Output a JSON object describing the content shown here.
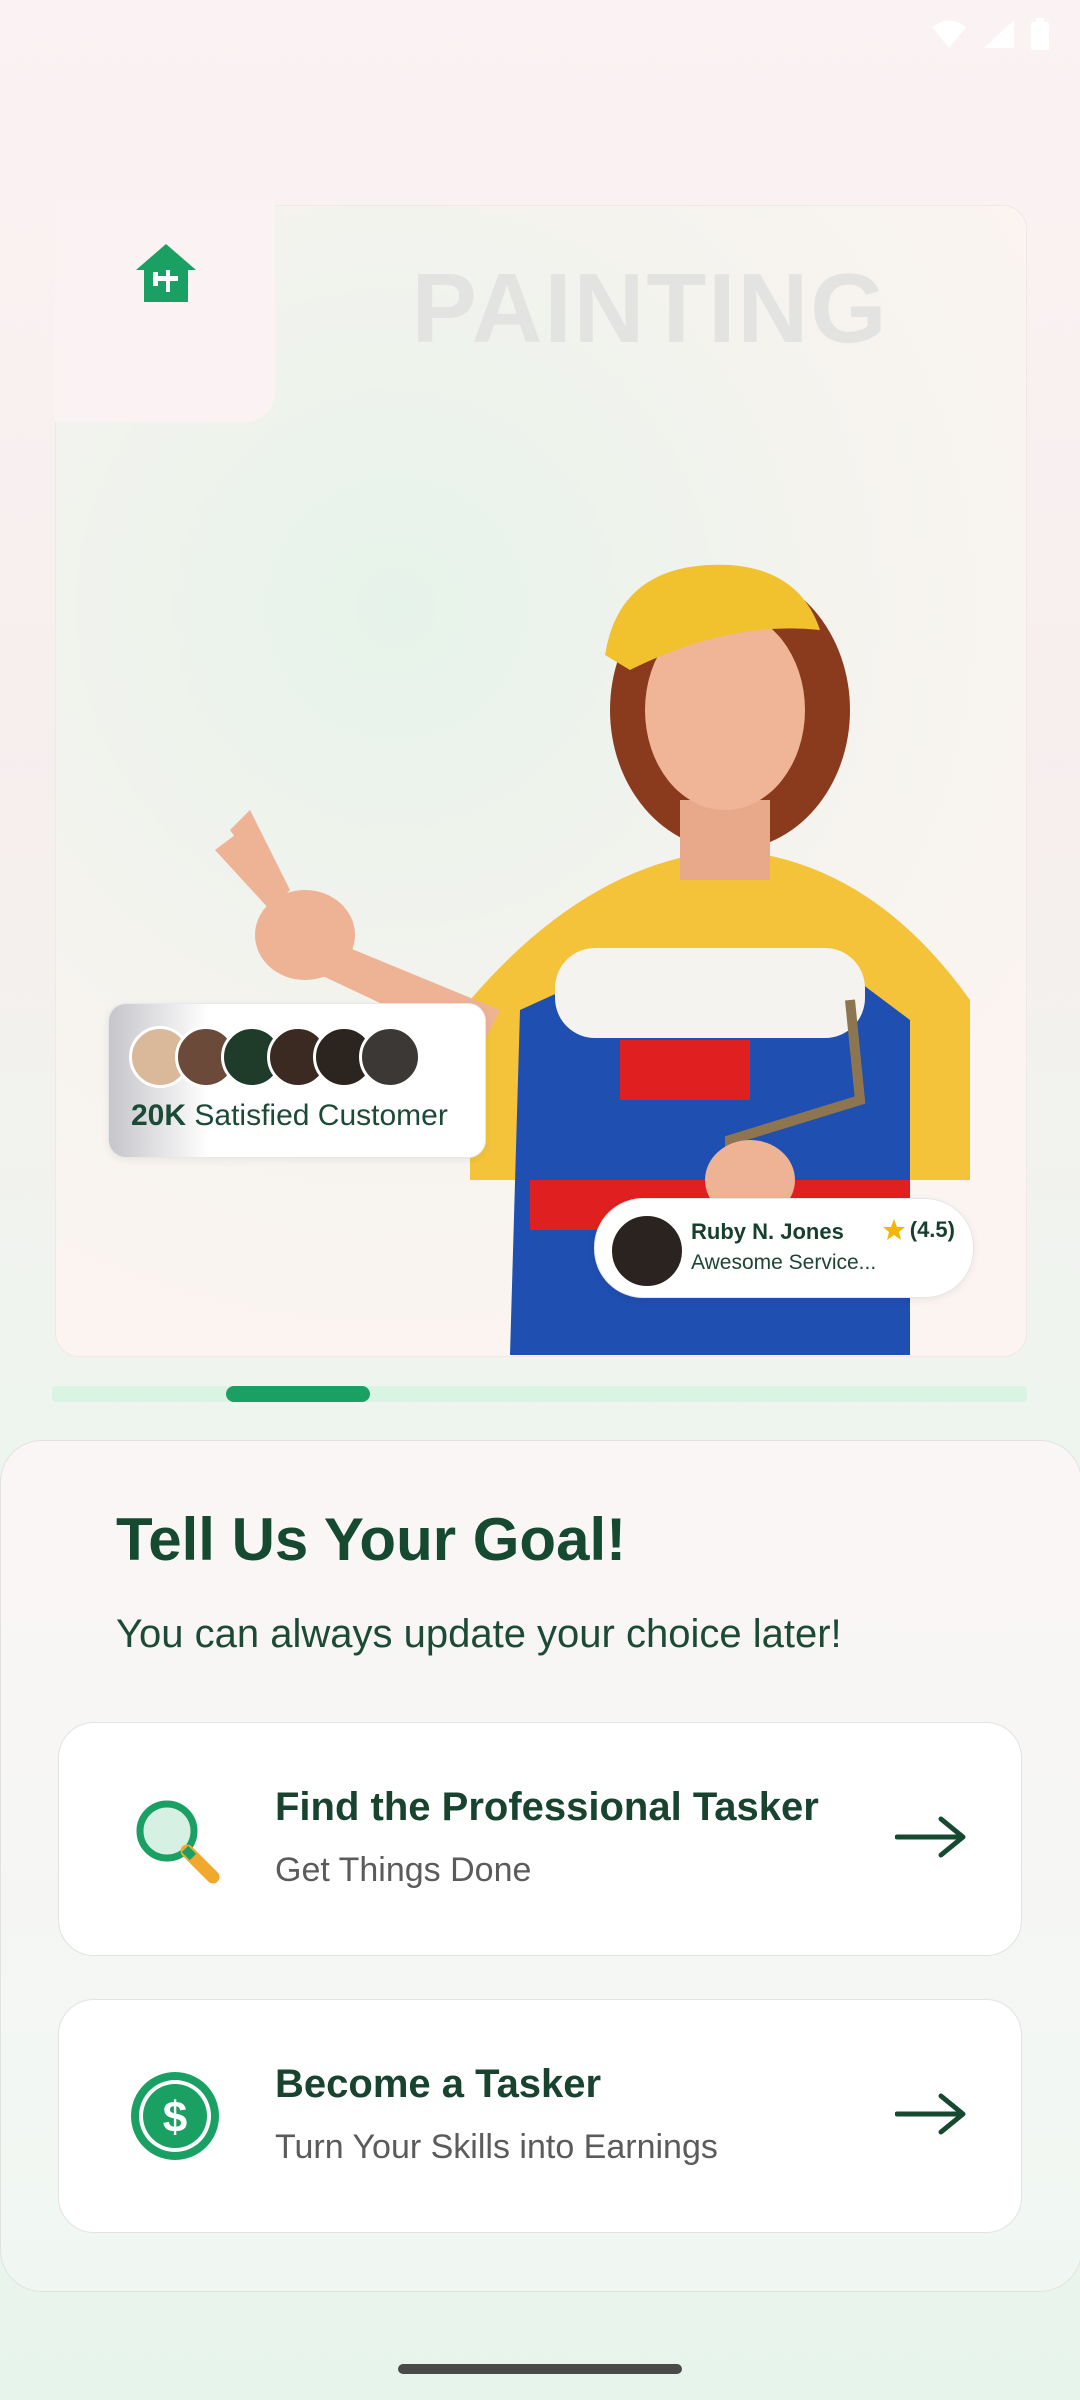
{
  "status_bar": {
    "icons": [
      "wifi-icon",
      "signal-icon",
      "battery-icon"
    ]
  },
  "hero": {
    "category": "PAINTING",
    "customers_count": "20K",
    "customers_label": "Satisfied Customer",
    "review": {
      "name": "Ruby N. Jones",
      "rating": "(4.5)",
      "text": "Awesome Service..."
    }
  },
  "pager": {
    "pages": 6,
    "active_index": 1
  },
  "goal": {
    "title": "Tell Us Your Goal!",
    "subtitle": "You can always update your choice later!",
    "options": [
      {
        "title": "Find the Professional Tasker",
        "subtitle": "Get Things Done",
        "icon": "search-icon"
      },
      {
        "title": "Become a Tasker",
        "subtitle": "Turn Your Skills into Earnings",
        "icon": "dollar-coin-icon"
      }
    ]
  },
  "colors": {
    "brand_green": "#1aa063",
    "dark_green": "#154a31",
    "star_yellow": "#f2b705"
  }
}
